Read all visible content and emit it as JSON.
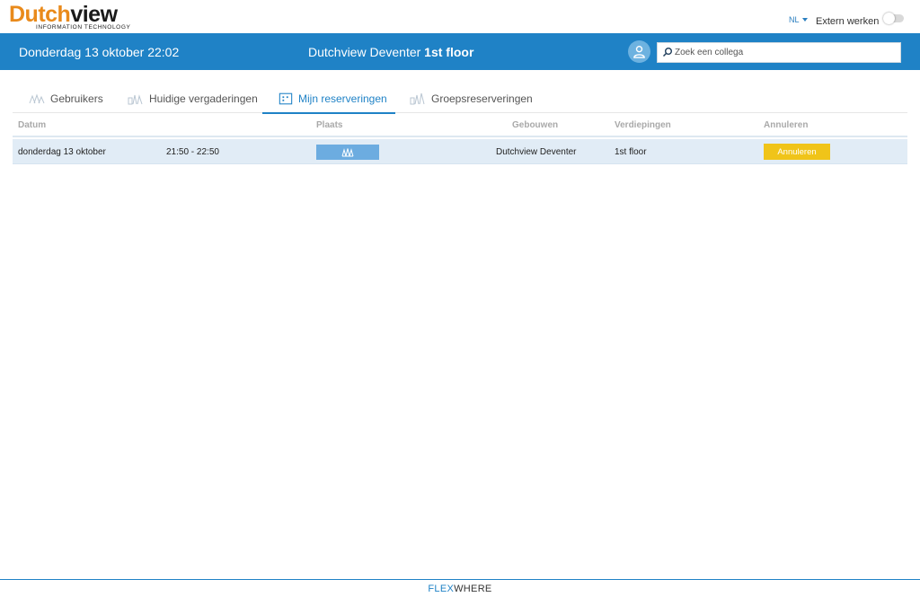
{
  "brand": {
    "name_part1": "Dutch",
    "name_part2": "view",
    "tagline": "INFORMATION TECHNOLOGY",
    "orange": "#e98a1b"
  },
  "topbar": {
    "language": "NL",
    "extern_label": "Extern werken",
    "extern_enabled": false
  },
  "header": {
    "datetime": "Donderdag 13 oktober 22:02",
    "location_name": "Dutchview Deventer",
    "location_floor": "1st floor",
    "search_placeholder": "Zoek een collega",
    "color": "#1f82c6"
  },
  "tabs": [
    {
      "label": "Gebruikers",
      "icon": "users-icon",
      "active": false
    },
    {
      "label": "Huidige vergaderingen",
      "icon": "meetings-icon",
      "active": false
    },
    {
      "label": "Mijn reserveringen",
      "icon": "calendar-icon",
      "active": true
    },
    {
      "label": "Groepsreserveringen",
      "icon": "group-icon",
      "active": false
    }
  ],
  "table": {
    "columns": [
      "Datum",
      "Plaats",
      "Gebouwen",
      "Verdiepingen",
      "Annuleren"
    ],
    "rows": [
      {
        "date": "donderdag 13 oktober",
        "time": "21:50 - 22:50",
        "place_icon": "meeting-room-icon",
        "building": "Dutchview Deventer",
        "floor": "1st floor",
        "cancel_label": "Annuleren"
      }
    ]
  },
  "footer": {
    "brand_part1": "FLEX",
    "brand_part2": "WHERE"
  }
}
